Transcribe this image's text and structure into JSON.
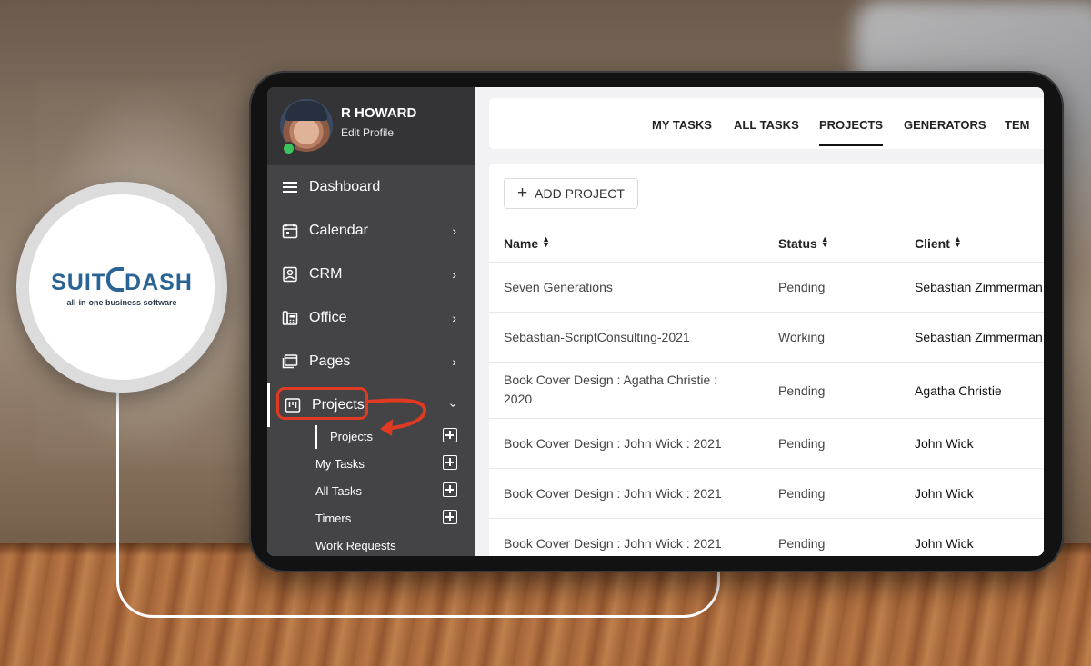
{
  "brand": {
    "logo_main_left": "SUIT",
    "logo_main_right": "DASH",
    "logo_sub": "all-in-one business software"
  },
  "profile": {
    "name": "R HOWARD",
    "edit_label": "Edit Profile",
    "status": "online"
  },
  "sidebar": {
    "items": [
      {
        "label": "Dashboard",
        "icon": "hamburger-menu-icon"
      },
      {
        "label": "Calendar",
        "icon": "calendar-icon"
      },
      {
        "label": "CRM",
        "icon": "contact-card-icon"
      },
      {
        "label": "Office",
        "icon": "office-phone-icon"
      },
      {
        "label": "Pages",
        "icon": "pages-icon"
      },
      {
        "label": "Projects",
        "icon": "kanban-board-icon"
      }
    ],
    "subitems": [
      {
        "label": "Projects"
      },
      {
        "label": "My Tasks"
      },
      {
        "label": "All Tasks"
      },
      {
        "label": "Timers"
      },
      {
        "label": "Work Requests"
      }
    ]
  },
  "tabs": [
    "MY TASKS",
    "ALL TASKS",
    "PROJECTS",
    "GENERATORS",
    "TEM"
  ],
  "toolbar": {
    "add_label": "ADD PROJECT"
  },
  "table": {
    "headers": [
      "Name",
      "Status",
      "Client"
    ],
    "rows": [
      {
        "name": "Seven Generations",
        "status": "Pending",
        "client": "Sebastian Zimmerman"
      },
      {
        "name": "Sebastian-ScriptConsulting-2021",
        "status": "Working",
        "client": "Sebastian Zimmerman"
      },
      {
        "name": "Book Cover Design : Agatha Christie : 2020",
        "status": "Pending",
        "client": "Agatha Christie"
      },
      {
        "name": "Book Cover Design : John Wick : 2021",
        "status": "Pending",
        "client": "John Wick"
      },
      {
        "name": "Book Cover Design : John Wick : 2021",
        "status": "Pending",
        "client": "John Wick"
      },
      {
        "name": "Book Cover Design : John Wick : 2021",
        "status": "Pending",
        "client": "John Wick"
      }
    ]
  },
  "colors": {
    "sidebar_bg": "#444446",
    "profile_bg": "#343436",
    "highlight": "#e03a22",
    "brand_blue": "#2a6396",
    "online": "#3cc35b"
  }
}
